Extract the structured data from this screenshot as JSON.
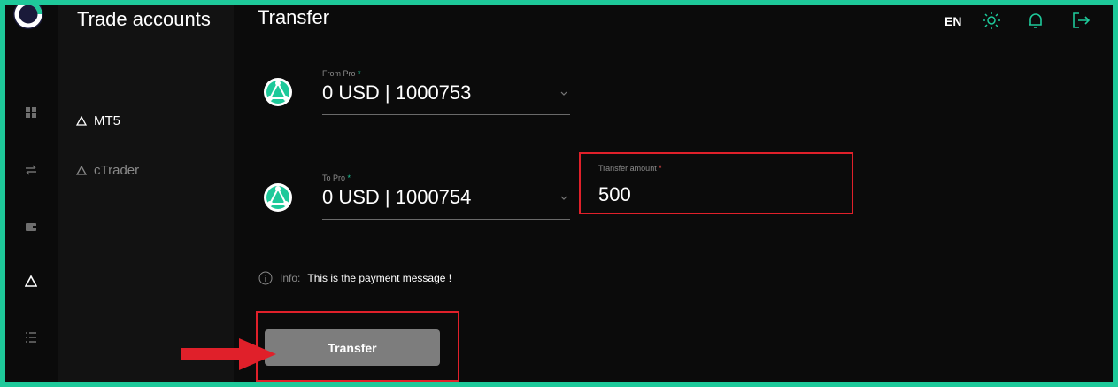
{
  "sidebar": {
    "title": "Trade accounts",
    "items": [
      {
        "label": "MT5",
        "active": true
      },
      {
        "label": "cTrader",
        "active": false
      }
    ]
  },
  "header": {
    "title": "Transfer",
    "language": "EN"
  },
  "form": {
    "from": {
      "label": "From Pro",
      "value": "0 USD | 1000753"
    },
    "to": {
      "label": "To Pro",
      "value": "0 USD | 1000754"
    },
    "amount": {
      "label": "Transfer amount",
      "value": "500"
    },
    "required_mark": "*",
    "info": {
      "label": "Info:",
      "message": "This is the payment message !"
    },
    "submit_label": "Transfer"
  },
  "colors": {
    "accent": "#1ec99a",
    "highlight": "#e0202a",
    "button": "#7d7d7d",
    "background": "#0b0b0b"
  },
  "icons": [
    "brand-logo-icon",
    "grid-icon",
    "swap-icon",
    "wallet-icon",
    "triangle-accounts-icon",
    "list-icon",
    "sun-icon",
    "bell-icon",
    "logout-icon",
    "chevron-down-icon",
    "info-icon",
    "arrow-right-icon"
  ]
}
